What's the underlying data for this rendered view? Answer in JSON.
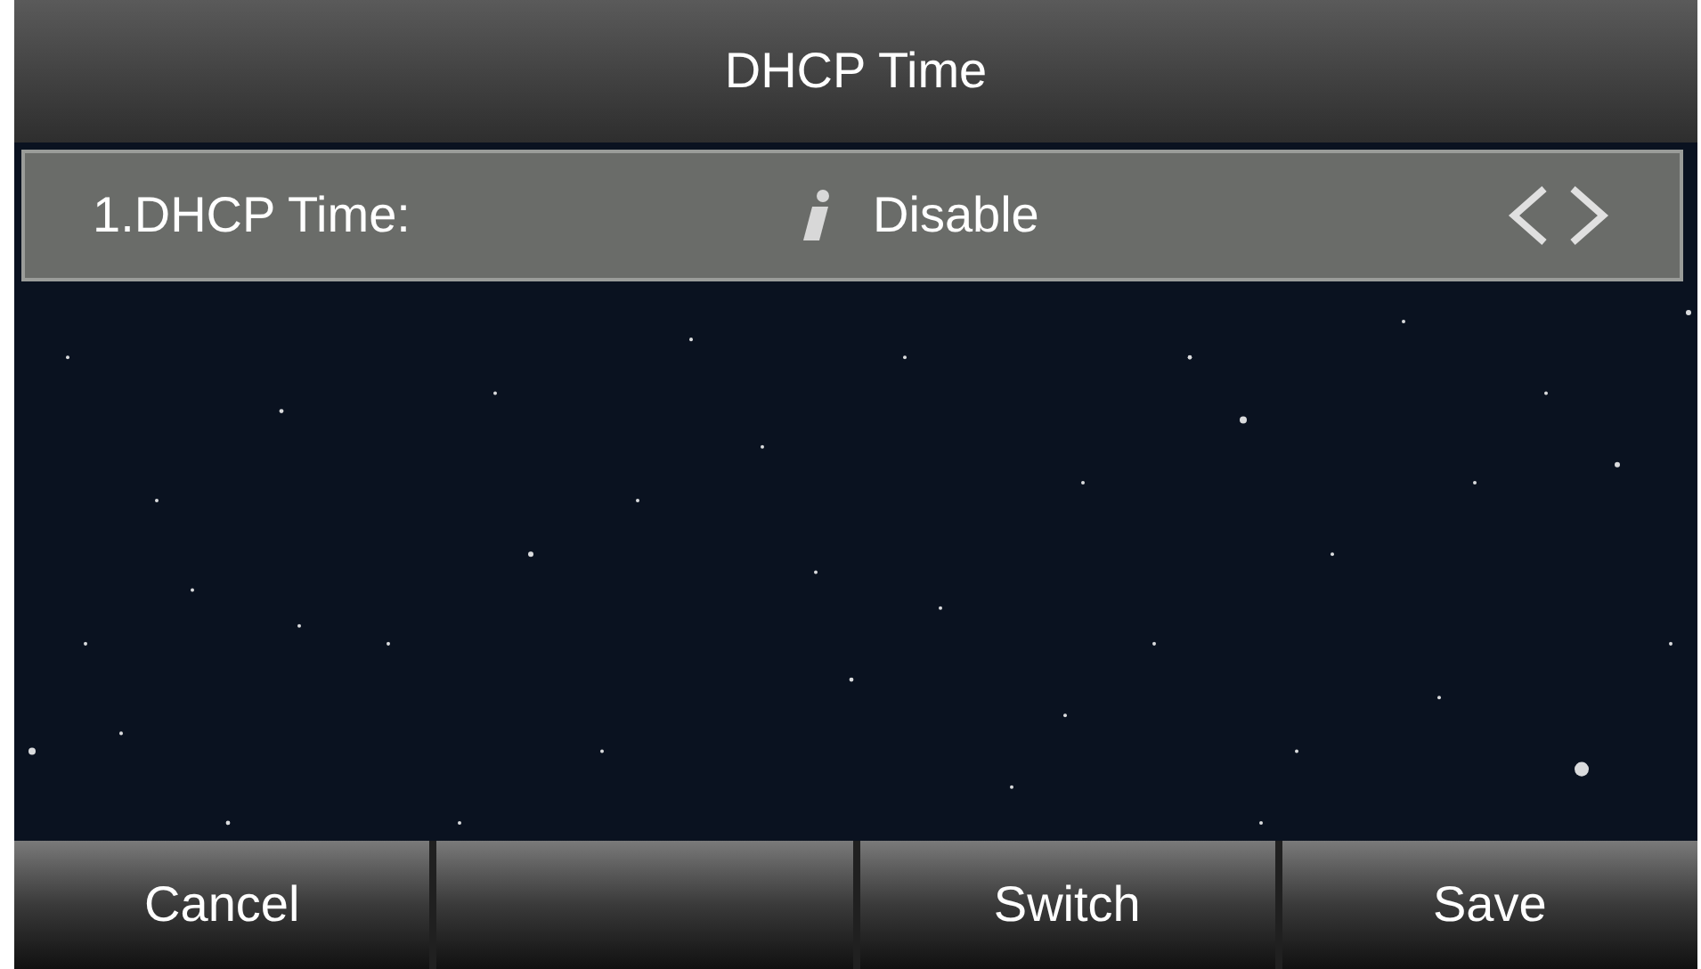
{
  "title": "DHCP Time",
  "items": [
    {
      "label": "1.DHCP Time:",
      "value": "Disable",
      "selected": true
    }
  ],
  "softkeys": [
    {
      "kind": "key",
      "label": "Cancel"
    },
    {
      "kind": "blank"
    },
    {
      "kind": "key",
      "label": "Switch"
    },
    {
      "kind": "key",
      "label": "Save"
    }
  ]
}
